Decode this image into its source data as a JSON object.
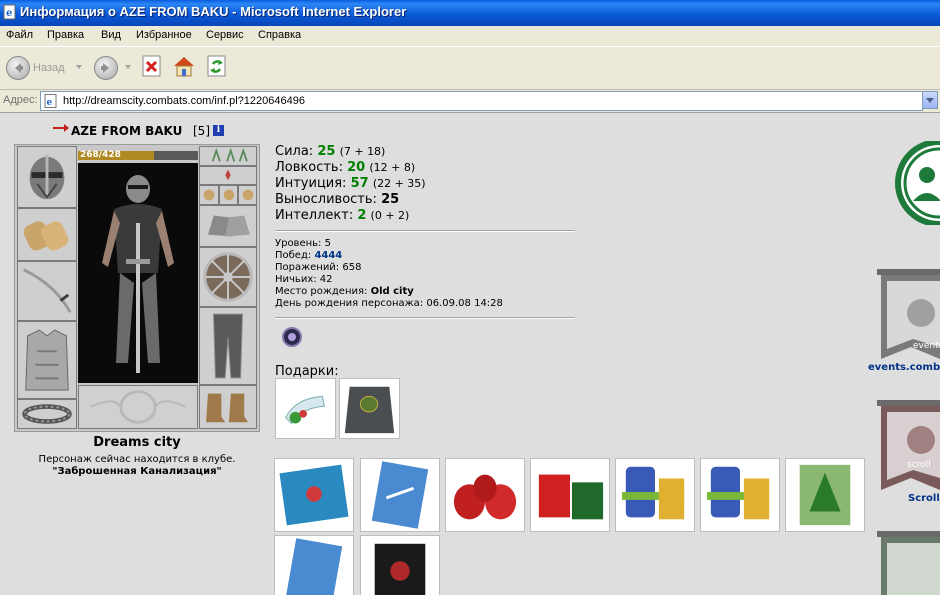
{
  "window": {
    "title": "Информация о AZE FROM BAKU - Microsoft Internet Explorer"
  },
  "menu": [
    "Файл",
    "Правка",
    "Вид",
    "Избранное",
    "Сервис",
    "Справка"
  ],
  "toolbar": {
    "back_label": "Назад"
  },
  "address": {
    "label": "Адрес:",
    "url": "http://dreamscity.combats.com/inf.pl?1220646496"
  },
  "character": {
    "name": "AZE FROM BAKU",
    "level": "[5]",
    "hp": "268/428",
    "hp_fraction": 0.63,
    "city": "Dreams city",
    "location_text": "Персонаж сейчас находится в клубе.",
    "location_name": "\"Заброшенная Канализация\""
  },
  "stats": [
    {
      "label": "Сила:",
      "value": "25",
      "detail": "(7 + 18)"
    },
    {
      "label": "Ловкость:",
      "value": "20",
      "detail": "(12 + 8)"
    },
    {
      "label": "Интуиция:",
      "value": "57",
      "detail": "(22 + 35)"
    },
    {
      "label": "Выносливость:",
      "value": "25",
      "detail": ""
    },
    {
      "label": "Интеллект:",
      "value": "2",
      "detail": "(0 + 2)"
    }
  ],
  "info": {
    "level": {
      "label": "Уровень:",
      "value": "5"
    },
    "wins": {
      "label": "Побед:",
      "value": "4444"
    },
    "losses": {
      "label": "Поражений:",
      "value": "658"
    },
    "draws": {
      "label": "Ничьих:",
      "value": "42"
    },
    "birthplace": {
      "label": "Место рождения:",
      "value": "Old city"
    },
    "birthday": {
      "label": "День рождения персонажа:",
      "value": "06.09.08 14:28"
    }
  },
  "gifts_label": "Подарки:",
  "sidebar": {
    "events_label": "events.combats",
    "events_caption": "events",
    "scroll_label": "Scroll",
    "scroll_caption": "scroll"
  },
  "colors": {
    "stat_green": "#007f00",
    "link_blue": "#003388",
    "hp_bar": "#b08a20"
  }
}
